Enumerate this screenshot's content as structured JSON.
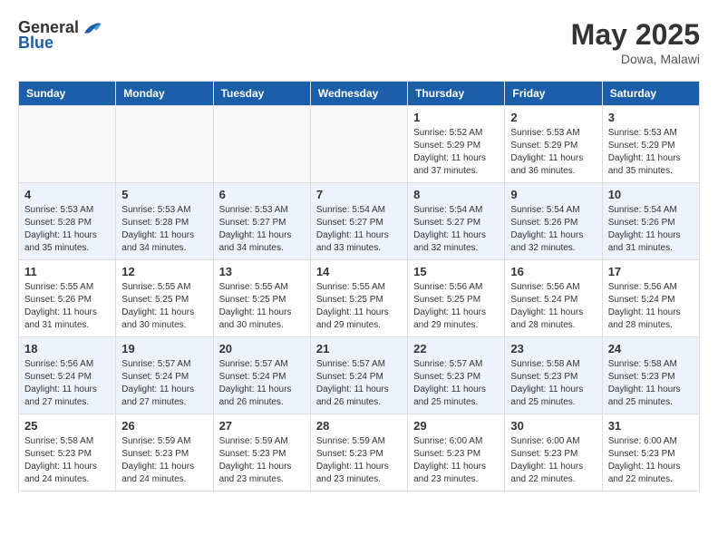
{
  "header": {
    "logo_general": "General",
    "logo_blue": "Blue",
    "month_year": "May 2025",
    "location": "Dowa, Malawi"
  },
  "days_of_week": [
    "Sunday",
    "Monday",
    "Tuesday",
    "Wednesday",
    "Thursday",
    "Friday",
    "Saturday"
  ],
  "weeks": [
    [
      {
        "day": "",
        "info": ""
      },
      {
        "day": "",
        "info": ""
      },
      {
        "day": "",
        "info": ""
      },
      {
        "day": "",
        "info": ""
      },
      {
        "day": "1",
        "info": "Sunrise: 5:52 AM\nSunset: 5:29 PM\nDaylight: 11 hours and 37 minutes."
      },
      {
        "day": "2",
        "info": "Sunrise: 5:53 AM\nSunset: 5:29 PM\nDaylight: 11 hours and 36 minutes."
      },
      {
        "day": "3",
        "info": "Sunrise: 5:53 AM\nSunset: 5:29 PM\nDaylight: 11 hours and 35 minutes."
      }
    ],
    [
      {
        "day": "4",
        "info": "Sunrise: 5:53 AM\nSunset: 5:28 PM\nDaylight: 11 hours and 35 minutes."
      },
      {
        "day": "5",
        "info": "Sunrise: 5:53 AM\nSunset: 5:28 PM\nDaylight: 11 hours and 34 minutes."
      },
      {
        "day": "6",
        "info": "Sunrise: 5:53 AM\nSunset: 5:27 PM\nDaylight: 11 hours and 34 minutes."
      },
      {
        "day": "7",
        "info": "Sunrise: 5:54 AM\nSunset: 5:27 PM\nDaylight: 11 hours and 33 minutes."
      },
      {
        "day": "8",
        "info": "Sunrise: 5:54 AM\nSunset: 5:27 PM\nDaylight: 11 hours and 32 minutes."
      },
      {
        "day": "9",
        "info": "Sunrise: 5:54 AM\nSunset: 5:26 PM\nDaylight: 11 hours and 32 minutes."
      },
      {
        "day": "10",
        "info": "Sunrise: 5:54 AM\nSunset: 5:26 PM\nDaylight: 11 hours and 31 minutes."
      }
    ],
    [
      {
        "day": "11",
        "info": "Sunrise: 5:55 AM\nSunset: 5:26 PM\nDaylight: 11 hours and 31 minutes."
      },
      {
        "day": "12",
        "info": "Sunrise: 5:55 AM\nSunset: 5:25 PM\nDaylight: 11 hours and 30 minutes."
      },
      {
        "day": "13",
        "info": "Sunrise: 5:55 AM\nSunset: 5:25 PM\nDaylight: 11 hours and 30 minutes."
      },
      {
        "day": "14",
        "info": "Sunrise: 5:55 AM\nSunset: 5:25 PM\nDaylight: 11 hours and 29 minutes."
      },
      {
        "day": "15",
        "info": "Sunrise: 5:56 AM\nSunset: 5:25 PM\nDaylight: 11 hours and 29 minutes."
      },
      {
        "day": "16",
        "info": "Sunrise: 5:56 AM\nSunset: 5:24 PM\nDaylight: 11 hours and 28 minutes."
      },
      {
        "day": "17",
        "info": "Sunrise: 5:56 AM\nSunset: 5:24 PM\nDaylight: 11 hours and 28 minutes."
      }
    ],
    [
      {
        "day": "18",
        "info": "Sunrise: 5:56 AM\nSunset: 5:24 PM\nDaylight: 11 hours and 27 minutes."
      },
      {
        "day": "19",
        "info": "Sunrise: 5:57 AM\nSunset: 5:24 PM\nDaylight: 11 hours and 27 minutes."
      },
      {
        "day": "20",
        "info": "Sunrise: 5:57 AM\nSunset: 5:24 PM\nDaylight: 11 hours and 26 minutes."
      },
      {
        "day": "21",
        "info": "Sunrise: 5:57 AM\nSunset: 5:24 PM\nDaylight: 11 hours and 26 minutes."
      },
      {
        "day": "22",
        "info": "Sunrise: 5:57 AM\nSunset: 5:23 PM\nDaylight: 11 hours and 25 minutes."
      },
      {
        "day": "23",
        "info": "Sunrise: 5:58 AM\nSunset: 5:23 PM\nDaylight: 11 hours and 25 minutes."
      },
      {
        "day": "24",
        "info": "Sunrise: 5:58 AM\nSunset: 5:23 PM\nDaylight: 11 hours and 25 minutes."
      }
    ],
    [
      {
        "day": "25",
        "info": "Sunrise: 5:58 AM\nSunset: 5:23 PM\nDaylight: 11 hours and 24 minutes."
      },
      {
        "day": "26",
        "info": "Sunrise: 5:59 AM\nSunset: 5:23 PM\nDaylight: 11 hours and 24 minutes."
      },
      {
        "day": "27",
        "info": "Sunrise: 5:59 AM\nSunset: 5:23 PM\nDaylight: 11 hours and 23 minutes."
      },
      {
        "day": "28",
        "info": "Sunrise: 5:59 AM\nSunset: 5:23 PM\nDaylight: 11 hours and 23 minutes."
      },
      {
        "day": "29",
        "info": "Sunrise: 6:00 AM\nSunset: 5:23 PM\nDaylight: 11 hours and 23 minutes."
      },
      {
        "day": "30",
        "info": "Sunrise: 6:00 AM\nSunset: 5:23 PM\nDaylight: 11 hours and 22 minutes."
      },
      {
        "day": "31",
        "info": "Sunrise: 6:00 AM\nSunset: 5:23 PM\nDaylight: 11 hours and 22 minutes."
      }
    ]
  ]
}
